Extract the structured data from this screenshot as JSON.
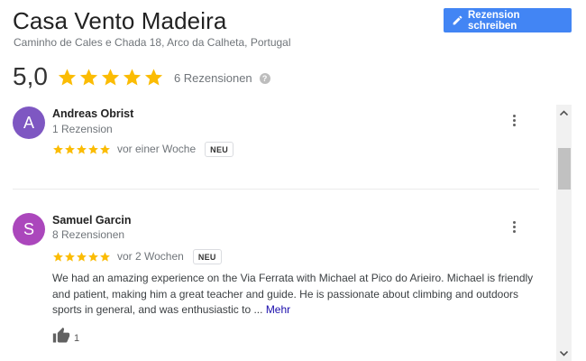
{
  "place": {
    "title": "Casa Vento Madeira",
    "address": "Caminho de Cales e Chada 18, Arco da Calheta, Portugal"
  },
  "actions": {
    "write_review_label": "Rezension schreiben",
    "write_review_icon": "pencil-icon"
  },
  "summary": {
    "score": "5,0",
    "stars": 5,
    "review_count_label": "6 Rezensionen",
    "help_icon": "help-icon",
    "help_symbol": "?"
  },
  "colors": {
    "accent": "#4285f4",
    "star": "#fbbc04",
    "link": "#1a0dab",
    "avatar_andreas": "#7e57c2",
    "avatar_samuel": "#ab47bc"
  },
  "reviews": [
    {
      "initial": "A",
      "name": "Andreas Obrist",
      "meta": "1 Rezension",
      "stars": 5,
      "when": "vor einer Woche",
      "badge": "NEU"
    },
    {
      "initial": "S",
      "name": "Samuel Garcin",
      "meta": "8 Rezensionen",
      "stars": 5,
      "when": "vor 2 Wochen",
      "badge": "NEU",
      "text": "We had an amazing experience on the Via Ferrata with Michael at Pico do Arieiro. Michael is friendly and patient, making him a great teacher and guide. He is passionate about climbing and outdoors sports in general, and was enthusiastic to ...",
      "more_label": "Mehr",
      "likes": "1"
    }
  ]
}
